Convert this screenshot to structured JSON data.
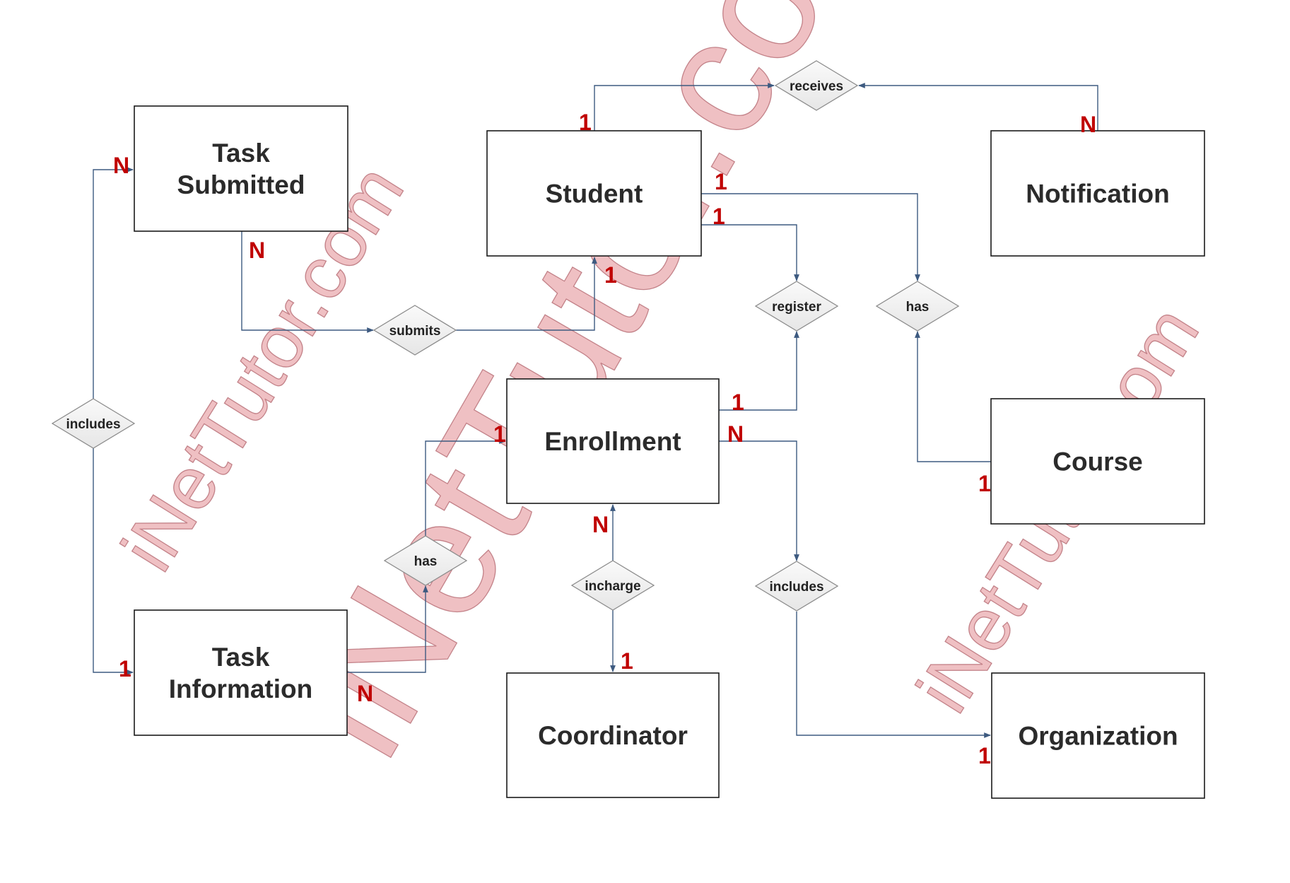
{
  "diagram": {
    "type": "er-diagram",
    "colors": {
      "connector": "#3d5a80",
      "cardinality": "#c00000",
      "entity_border": "#1a1a1a",
      "relationship_fill": "#eeeeee",
      "watermark": "#e8a6aa"
    },
    "entities": [
      {
        "id": "task_submitted",
        "lines": [
          "Task",
          "Submitted"
        ]
      },
      {
        "id": "student",
        "lines": [
          "Student"
        ]
      },
      {
        "id": "notification",
        "lines": [
          "Notification"
        ]
      },
      {
        "id": "enrollment",
        "lines": [
          "Enrollment"
        ]
      },
      {
        "id": "course",
        "lines": [
          "Course"
        ]
      },
      {
        "id": "task_information",
        "lines": [
          "Task",
          "Information"
        ]
      },
      {
        "id": "coordinator",
        "lines": [
          "Coordinator"
        ]
      },
      {
        "id": "organization",
        "lines": [
          "Organization"
        ]
      }
    ],
    "relationships": [
      {
        "id": "receives",
        "label": "receives",
        "from": "student",
        "from_card": "1",
        "to": "notification",
        "to_card": "N"
      },
      {
        "id": "submits",
        "label": "submits",
        "from": "task_submitted",
        "from_card": "N",
        "to": "student",
        "to_card": "1"
      },
      {
        "id": "register",
        "label": "register",
        "from": "student",
        "from_card": "1",
        "to": "enrollment",
        "to_card": "1"
      },
      {
        "id": "has_course",
        "label": "has",
        "from": "student",
        "from_card": "1",
        "to": "course",
        "to_card": "1"
      },
      {
        "id": "includes_task",
        "label": "includes",
        "from": "task_submitted",
        "from_card": "N",
        "to": "task_information",
        "to_card": "1"
      },
      {
        "id": "has_task",
        "label": "has",
        "from": "enrollment",
        "from_card": "1",
        "to": "task_information",
        "to_card": "N"
      },
      {
        "id": "incharge",
        "label": "incharge",
        "from": "enrollment",
        "from_card": "N",
        "to": "coordinator",
        "to_card": "1"
      },
      {
        "id": "includes_org",
        "label": "includes",
        "from": "enrollment",
        "from_card": "N",
        "to": "organization",
        "to_card": "1"
      }
    ],
    "watermark": {
      "text_small": "iNetTutor.com",
      "text_large": "iNetTutor.com"
    }
  }
}
